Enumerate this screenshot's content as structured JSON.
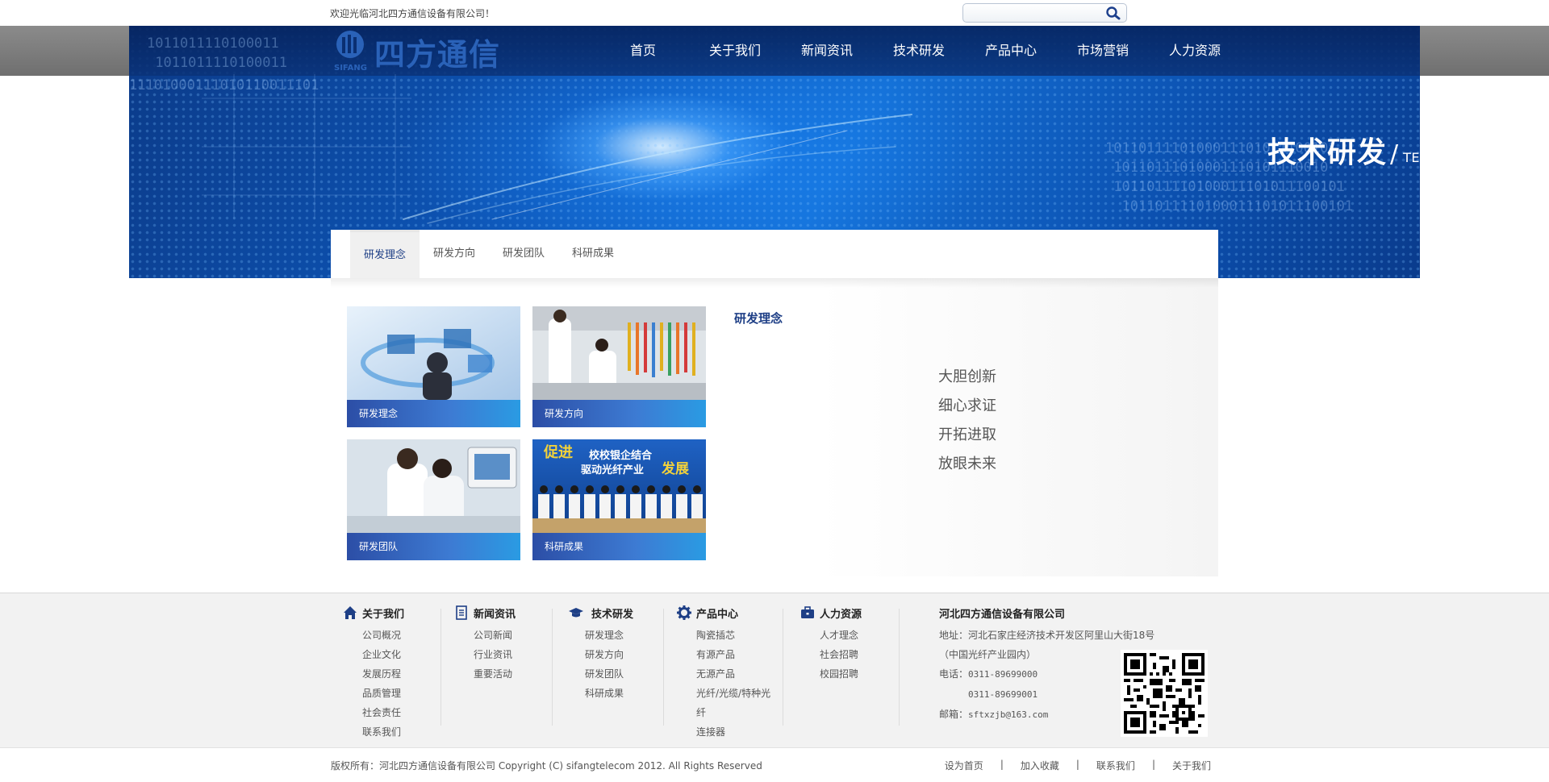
{
  "top": {
    "welcome": "欢迎光临河北四方通信设备有限公司！",
    "search_value": ""
  },
  "logo": {
    "text": "四方通信",
    "mark_text": "SIFANG"
  },
  "nav": [
    "首页",
    "关于我们",
    "新闻资讯",
    "技术研发",
    "产品中心",
    "市场营销",
    "人力资源"
  ],
  "banner": {
    "title_cn": "技术研发",
    "title_en": "TECHNOLOGY",
    "binary_1": "1011011110100011\n 1011011110100011",
    "binary_2": "11101000111010110011101",
    "binary_3": "1011011110100011101011100101\n 10110111010001110101110010\n 1011011110100011101011100101\n  1011011110100011101011100101"
  },
  "subtabs": [
    "研发理念",
    "研发方向",
    "研发团队",
    "科研成果"
  ],
  "active_subtab": "研发理念",
  "tiles": [
    "研发理念",
    "研发方向",
    "研发团队",
    "科研成果"
  ],
  "tile3_banner": {
    "line1": "促进",
    "line2": "校校银企结合",
    "line3": "驱动光纤产业",
    "line4": "发展"
  },
  "content": {
    "title": "研发理念",
    "motto": [
      "大胆创新",
      "细心求证",
      "开拓进取",
      "放眼未来"
    ]
  },
  "footer": {
    "columns": [
      {
        "icon": "home-icon",
        "title": "关于我们",
        "items": [
          "公司概况",
          "企业文化",
          "发展历程",
          "品质管理",
          "社会责任",
          "联系我们"
        ]
      },
      {
        "icon": "document-icon",
        "title": "新闻资讯",
        "items": [
          "公司新闻",
          "行业资讯",
          "重要活动"
        ]
      },
      {
        "icon": "graduation-cap-icon",
        "title": "技术研发",
        "items": [
          "研发理念",
          "研发方向",
          "研发团队",
          "科研成果"
        ]
      },
      {
        "icon": "gear-icon",
        "title": "产品中心",
        "items": [
          "陶瓷插芯",
          "有源产品",
          "无源产品",
          "光纤/光缆/特种光",
          "纤",
          "连接器"
        ]
      },
      {
        "icon": "briefcase-icon",
        "title": "人力资源",
        "items": [
          "人才理念",
          "社会招聘",
          "校园招聘"
        ]
      }
    ],
    "company": {
      "name": "河北四方通信设备有限公司",
      "address": "地址：河北石家庄经济技术开发区阿里山大街18号",
      "address2": "（中国光纤产业园内）",
      "phone_label": "电话：",
      "phone1": "0311-89699000",
      "phone2": "0311-89699001",
      "email_label": "邮箱：",
      "email": "sftxzjb@163.com"
    },
    "copyright": "版权所有：河北四方通信设备有限公司 Copyright (C) sifangtelecom 2012. All Rights Reserved",
    "links": [
      "设为首页",
      "加入收藏",
      "联系我们",
      "关于我们"
    ],
    "link_sep": "|"
  },
  "colors": {
    "brand_blue": "#1e3f86",
    "banner_blue": "#0d56b8",
    "caption_blue": "#3d7bd3"
  }
}
